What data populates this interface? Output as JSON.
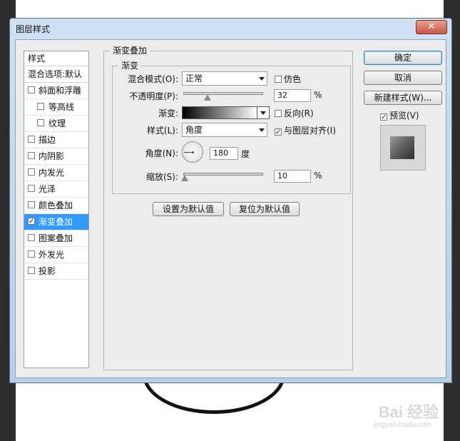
{
  "dialog": {
    "title": "图层样式",
    "close_label": "✕"
  },
  "style_list": {
    "header": "样式",
    "blend_options": "混合选项:默认",
    "items": [
      {
        "label": "斜面和浮雕",
        "checked": false,
        "sub": false
      },
      {
        "label": "等高线",
        "checked": false,
        "sub": true
      },
      {
        "label": "纹理",
        "checked": false,
        "sub": true
      },
      {
        "label": "描边",
        "checked": false,
        "sub": false
      },
      {
        "label": "内阴影",
        "checked": false,
        "sub": false
      },
      {
        "label": "内发光",
        "checked": false,
        "sub": false
      },
      {
        "label": "光泽",
        "checked": false,
        "sub": false
      },
      {
        "label": "颜色叠加",
        "checked": false,
        "sub": false
      },
      {
        "label": "渐变叠加",
        "checked": true,
        "sub": false,
        "selected": true
      },
      {
        "label": "图案叠加",
        "checked": false,
        "sub": false
      },
      {
        "label": "外发光",
        "checked": false,
        "sub": false
      },
      {
        "label": "投影",
        "checked": false,
        "sub": false
      }
    ]
  },
  "panel": {
    "group_title": "渐变叠加",
    "sub_group_title": "渐变",
    "blend_mode_label": "混合模式(O):",
    "blend_mode_value": "正常",
    "dither_label": "仿色",
    "opacity_label": "不透明度(P):",
    "opacity_value": "32",
    "opacity_unit": "%",
    "gradient_label": "渐变:",
    "reverse_label": "反向(R)",
    "style_label": "样式(L):",
    "style_value": "角度",
    "align_label": "与图层对齐(I)",
    "angle_label": "角度(N):",
    "angle_value": "180",
    "angle_unit": "度",
    "scale_label": "缩放(S):",
    "scale_value": "10",
    "scale_unit": "%",
    "set_default_label": "设置为默认值",
    "reset_default_label": "复位为默认值"
  },
  "side": {
    "ok_label": "确定",
    "cancel_label": "取消",
    "new_style_label": "新建样式(W)...",
    "preview_label": "预览(V)"
  },
  "watermark": {
    "text": "Bai 经验",
    "sub": "jingyan.baidu.com"
  }
}
